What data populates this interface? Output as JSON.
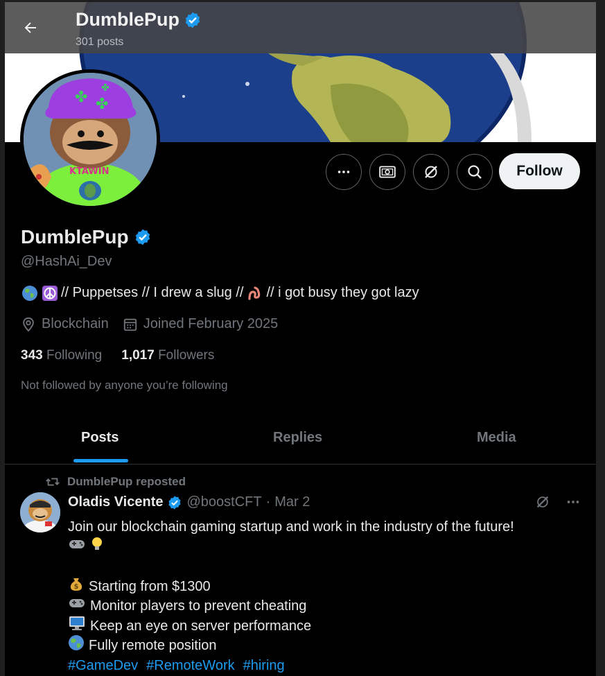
{
  "header": {
    "title": "DumblePup",
    "post_count": "301 posts"
  },
  "profile": {
    "display_name": "DumblePup",
    "handle": "@HashAi_Dev",
    "bio": {
      "parts": [
        "// Puppetses // I drew a slug //",
        "// i got busy they got lazy"
      ]
    },
    "location": "Blockchain",
    "joined": "Joined February 2025",
    "following_count": "343",
    "following_label": "Following",
    "followers_count": "1,017",
    "followers_label": "Followers",
    "followed_by": "Not followed by anyone you’re following"
  },
  "actions": {
    "follow_label": "Follow"
  },
  "tabs": [
    {
      "label": "Posts",
      "active": true
    },
    {
      "label": "Replies",
      "active": false
    },
    {
      "label": "Media",
      "active": false
    }
  ],
  "post": {
    "repost_label": "DumblePup reposted",
    "author": "Oladis Vicente",
    "handle": "@boostCFT",
    "separator": "·",
    "date": "Mar 2",
    "lines": [
      "Join our blockchain gaming startup and work in the industry of the future!",
      "Starting from $1300",
      "Monitor players to prevent cheating",
      "Keep an eye on server performance",
      "Fully remote position"
    ],
    "hashtags": [
      "#GameDev",
      "#RemoteWork",
      "#hiring"
    ]
  },
  "colors": {
    "accent": "#1d9bf0",
    "verified": "#1d9bf0",
    "muted": "#71767b",
    "background": "#000000"
  },
  "icons": {
    "back": "arrow-left-icon",
    "verified": "verified-badge-icon",
    "more": "more-horizontal-icon",
    "subscribe": "money-icon",
    "grok": "grok-icon",
    "search": "search-icon",
    "location": "location-pin-icon",
    "calendar": "calendar-icon",
    "repost": "repost-icon"
  }
}
